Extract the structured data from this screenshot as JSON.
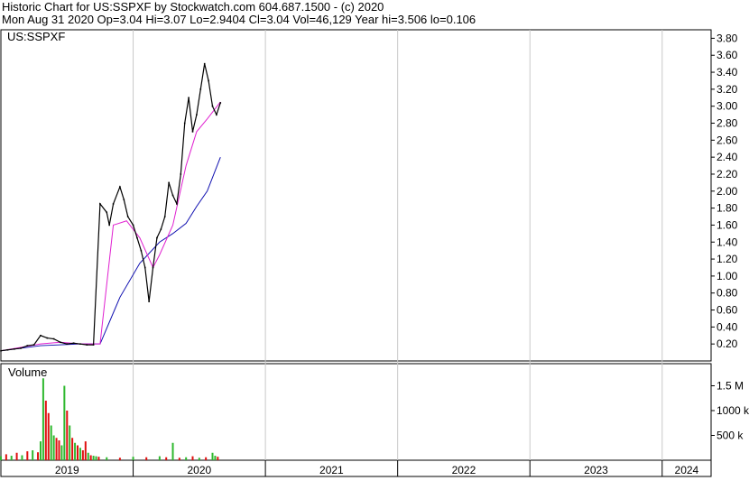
{
  "header": {
    "line1": "Historic Chart for US:SSPXF by Stockwatch.com 604.687.1500 - (c) 2020",
    "line2": "Mon Aug 31 2020  Op=3.04  Hi=3.07  Lo=2.9404  Cl=3.04  Vol=46,129  Year hi=3.506  lo=0.106"
  },
  "colors": {
    "price": "#000000",
    "ma_short": "#e020d0",
    "ma_long": "#1010b0",
    "vol_up": "#2eb82e",
    "vol_down": "#e01010",
    "grid": "#c8c8c8",
    "border": "#000000"
  },
  "chart_data": {
    "type": "line",
    "title": "US:SSPXF",
    "price_yticks": [
      "3.80",
      "3.60",
      "3.40",
      "3.20",
      "3.00",
      "2.80",
      "2.60",
      "2.40",
      "2.20",
      "2.00",
      "1.80",
      "1.60",
      "1.40",
      "1.20",
      "1.00",
      "0.80",
      "0.60",
      "0.40",
      "0.20"
    ],
    "price_ylim": [
      0.0,
      3.9
    ],
    "volume_label": "Volume",
    "volume_yticks": [
      "1.5 M",
      "1000 k",
      "500 k"
    ],
    "volume_ylim": [
      0,
      1800000
    ],
    "year_labels": [
      "2019",
      "2020",
      "2021",
      "2022",
      "2023",
      "2024"
    ],
    "price_series": {
      "name": "Close",
      "x": [
        2019.0,
        2019.05,
        2019.1,
        2019.15,
        2019.2,
        2019.25,
        2019.3,
        2019.35,
        2019.4,
        2019.45,
        2019.5,
        2019.55,
        2019.6,
        2019.65,
        2019.7,
        2019.75,
        2019.8,
        2019.82,
        2019.85,
        2019.9,
        2019.93,
        2019.96,
        2020.0,
        2020.03,
        2020.06,
        2020.09,
        2020.12,
        2020.15,
        2020.18,
        2020.21,
        2020.24,
        2020.27,
        2020.3,
        2020.33,
        2020.36,
        2020.39,
        2020.42,
        2020.45,
        2020.48,
        2020.51,
        2020.54,
        2020.57,
        2020.6,
        2020.63,
        2020.66
      ],
      "values": [
        0.12,
        0.13,
        0.14,
        0.15,
        0.18,
        0.19,
        0.3,
        0.27,
        0.26,
        0.22,
        0.2,
        0.21,
        0.2,
        0.19,
        0.19,
        1.85,
        1.75,
        1.6,
        1.85,
        2.05,
        1.9,
        1.7,
        1.6,
        1.45,
        1.3,
        1.1,
        0.7,
        1.1,
        1.45,
        1.55,
        1.7,
        2.1,
        1.95,
        1.85,
        2.2,
        2.8,
        3.1,
        2.7,
        2.9,
        3.2,
        3.5,
        3.3,
        3.0,
        2.9,
        3.04
      ]
    },
    "ma_short_series": {
      "x": [
        2019.0,
        2019.3,
        2019.45,
        2019.6,
        2019.75,
        2019.85,
        2019.95,
        2020.05,
        2020.15,
        2020.2,
        2020.3,
        2020.4,
        2020.48,
        2020.56,
        2020.66
      ],
      "values": [
        0.12,
        0.2,
        0.22,
        0.2,
        0.2,
        1.6,
        1.65,
        1.45,
        1.1,
        1.25,
        1.6,
        2.3,
        2.7,
        2.85,
        3.05
      ]
    },
    "ma_long_series": {
      "x": [
        2019.0,
        2019.3,
        2019.6,
        2019.75,
        2019.9,
        2020.05,
        2020.2,
        2020.3,
        2020.4,
        2020.48,
        2020.56,
        2020.66
      ],
      "values": [
        0.12,
        0.18,
        0.2,
        0.2,
        0.75,
        1.15,
        1.4,
        1.5,
        1.62,
        1.82,
        2.0,
        2.4
      ]
    },
    "volume_series": {
      "x": [
        2019.0,
        2019.04,
        2019.08,
        2019.12,
        2019.16,
        2019.2,
        2019.24,
        2019.28,
        2019.3,
        2019.32,
        2019.34,
        2019.36,
        2019.38,
        2019.4,
        2019.42,
        2019.44,
        2019.46,
        2019.48,
        2019.5,
        2019.52,
        2019.54,
        2019.56,
        2019.58,
        2019.6,
        2019.62,
        2019.64,
        2019.66,
        2019.68,
        2019.7,
        2019.72,
        2019.74,
        2019.8,
        2019.9,
        2020.0,
        2020.1,
        2020.2,
        2020.25,
        2020.3,
        2020.35,
        2020.4,
        2020.45,
        2020.5,
        2020.55,
        2020.6,
        2020.62,
        2020.64
      ],
      "values": [
        80000,
        120000,
        90000,
        150000,
        100000,
        180000,
        200000,
        160000,
        380000,
        1650000,
        1200000,
        950000,
        700000,
        500000,
        450000,
        400000,
        300000,
        1500000,
        1000000,
        700000,
        450000,
        350000,
        300000,
        250000,
        200000,
        380000,
        150000,
        100000,
        90000,
        80000,
        70000,
        60000,
        50000,
        70000,
        60000,
        80000,
        60000,
        350000,
        50000,
        60000,
        80000,
        50000,
        60000,
        150000,
        90000,
        70000
      ],
      "up": [
        true,
        false,
        true,
        false,
        true,
        false,
        true,
        false,
        true,
        true,
        false,
        false,
        true,
        true,
        false,
        false,
        true,
        true,
        false,
        true,
        false,
        true,
        false,
        true,
        false,
        false,
        true,
        false,
        true,
        true,
        false,
        true,
        false,
        true,
        false,
        true,
        false,
        true,
        false,
        true,
        false,
        true,
        false,
        true,
        true,
        false
      ]
    }
  }
}
